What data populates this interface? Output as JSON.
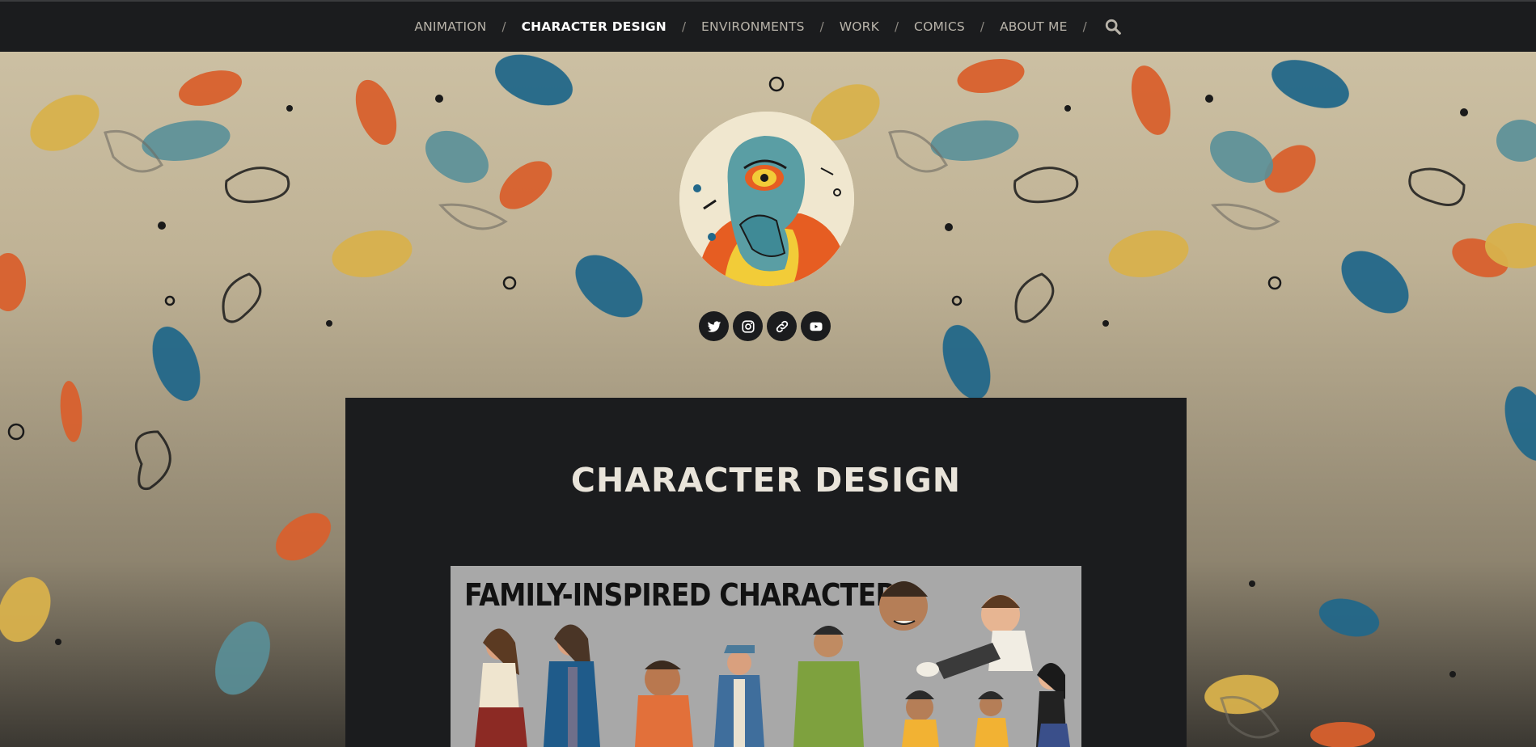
{
  "nav": {
    "items": [
      {
        "label": "ANIMATION",
        "active": false
      },
      {
        "label": "CHARACTER DESIGN",
        "active": true
      },
      {
        "label": "ENVIRONMENTS",
        "active": false
      },
      {
        "label": "WORK",
        "active": false
      },
      {
        "label": "COMICS",
        "active": false
      },
      {
        "label": "ABOUT ME",
        "active": false
      }
    ],
    "separator": "/",
    "search_icon": "search-icon"
  },
  "social": [
    "twitter-icon",
    "instagram-icon",
    "link-icon",
    "youtube-icon"
  ],
  "page": {
    "title": "CHARACTER DESIGN",
    "artwork_title": "FAMILY-INSPIRED CHARACTERS"
  },
  "colors": {
    "navbar": "#1b1c1e",
    "accent_orange": "#d8602e",
    "accent_blue": "#22688a",
    "accent_teal": "#5a9099",
    "accent_yellow": "#d8b24c",
    "panel": "#1b1c1e"
  }
}
